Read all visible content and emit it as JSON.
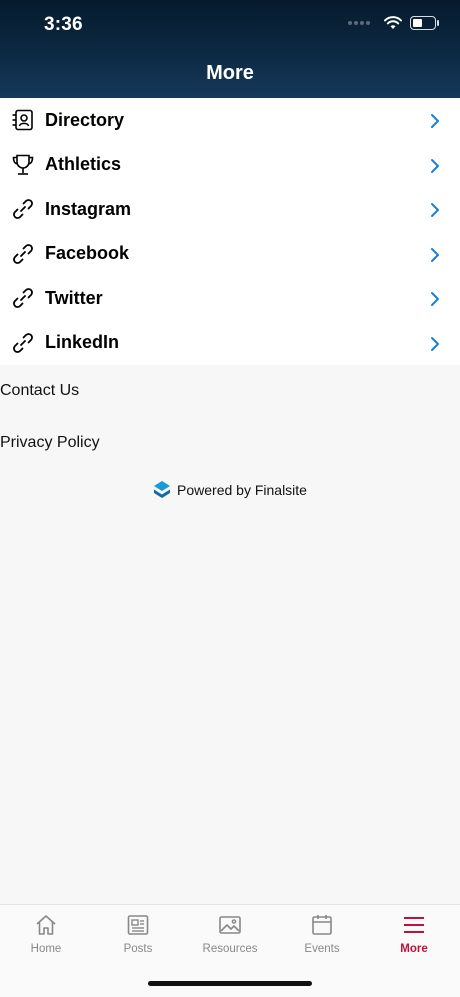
{
  "status": {
    "time": "3:36"
  },
  "header": {
    "title": "More"
  },
  "menu": [
    {
      "label": "Directory",
      "icon": "directory-icon"
    },
    {
      "label": "Athletics",
      "icon": "trophy-icon"
    },
    {
      "label": "Instagram",
      "icon": "link-icon"
    },
    {
      "label": "Facebook",
      "icon": "link-icon"
    },
    {
      "label": "Twitter",
      "icon": "link-icon"
    },
    {
      "label": "LinkedIn",
      "icon": "link-icon"
    }
  ],
  "footer_links": {
    "contact": "Contact Us",
    "privacy": "Privacy Policy",
    "powered": "Powered by Finalsite"
  },
  "tabs": [
    {
      "label": "Home",
      "icon": "home-icon"
    },
    {
      "label": "Posts",
      "icon": "posts-icon"
    },
    {
      "label": "Resources",
      "icon": "resources-icon"
    },
    {
      "label": "Events",
      "icon": "events-icon"
    },
    {
      "label": "More",
      "icon": "menu-icon",
      "active": true
    }
  ],
  "colors": {
    "accent": "#c0113a",
    "chevron": "#1a7fd4",
    "header": "#0d2b45",
    "powered_logo": "#1a9ad6"
  }
}
